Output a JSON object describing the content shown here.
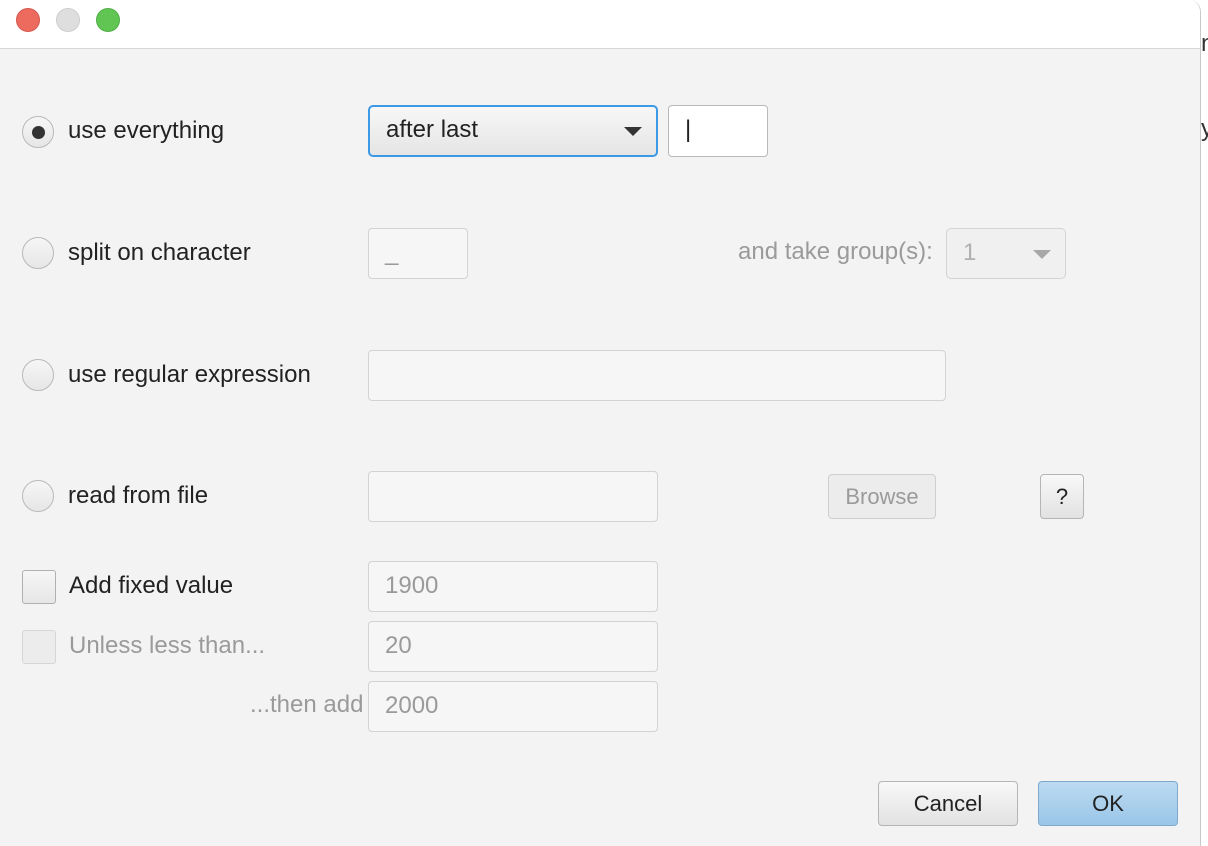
{
  "window": {
    "controls": [
      "close-button",
      "minimize-button",
      "zoom-button"
    ]
  },
  "background_edge": {
    "glyph_top": "n",
    "glyph_mid": "y"
  },
  "options": {
    "use_everything": {
      "label": "use everything",
      "selected": true,
      "position_select": "after last",
      "position_char": "|"
    },
    "split_on_character": {
      "label": "split on character",
      "char_value": "_",
      "group_label": "and take group(s):",
      "group_value": "1"
    },
    "regex": {
      "label": "use regular expression",
      "value": ""
    },
    "read_from_file": {
      "label": "read from file",
      "value": "",
      "browse_label": "Browse",
      "help_label": "?"
    }
  },
  "fixed_value": {
    "add_label": "Add fixed value",
    "add_value": "1900",
    "unless_label": "Unless less than...",
    "unless_value": "20",
    "then_label": "...then add",
    "then_value": "2000"
  },
  "buttons": {
    "cancel": "Cancel",
    "ok": "OK"
  },
  "colors": {
    "focus_accent": "#3b99e6",
    "default_button": "#a9cfec",
    "close": "#ed6a5e",
    "zoom": "#61c554"
  }
}
